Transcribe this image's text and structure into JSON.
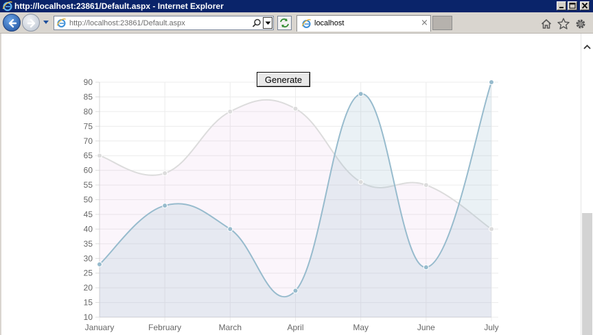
{
  "window": {
    "title": "http://localhost:23861/Default.aspx - Internet Explorer",
    "controls": {
      "minimize": "minimize",
      "maximize": "maximize",
      "close": "close"
    }
  },
  "toolbar": {
    "address": "http://localhost:23861/Default.aspx",
    "tab_label": "localhost",
    "tab_close": "×",
    "icons": [
      "back-icon",
      "forward-icon",
      "dropdown-icon",
      "ie-icon",
      "search-icon",
      "refresh-icon",
      "home-icon",
      "star-icon",
      "gear-icon"
    ]
  },
  "page": {
    "generate_label": "Generate"
  },
  "chart_data": {
    "type": "line",
    "categories": [
      "January",
      "February",
      "March",
      "April",
      "May",
      "June",
      "July"
    ],
    "ylim": [
      10,
      90
    ],
    "yticks": [
      10,
      15,
      20,
      25,
      30,
      35,
      40,
      45,
      50,
      55,
      60,
      65,
      70,
      75,
      80,
      85,
      90
    ],
    "grid": true,
    "curved": true,
    "filled": true,
    "series": [
      {
        "values": [
          65,
          59,
          80,
          81,
          56,
          55,
          40
        ],
        "line_color": "#dcdcdc",
        "fill_color": "rgba(220,160,220,0.10)",
        "point_color": "#dcdcdc"
      },
      {
        "values": [
          28,
          48,
          40,
          19,
          86,
          27,
          90
        ],
        "line_color": "#97bbcd",
        "fill_color": "rgba(151,187,205,0.20)",
        "point_color": "#97bbcd"
      }
    ]
  }
}
